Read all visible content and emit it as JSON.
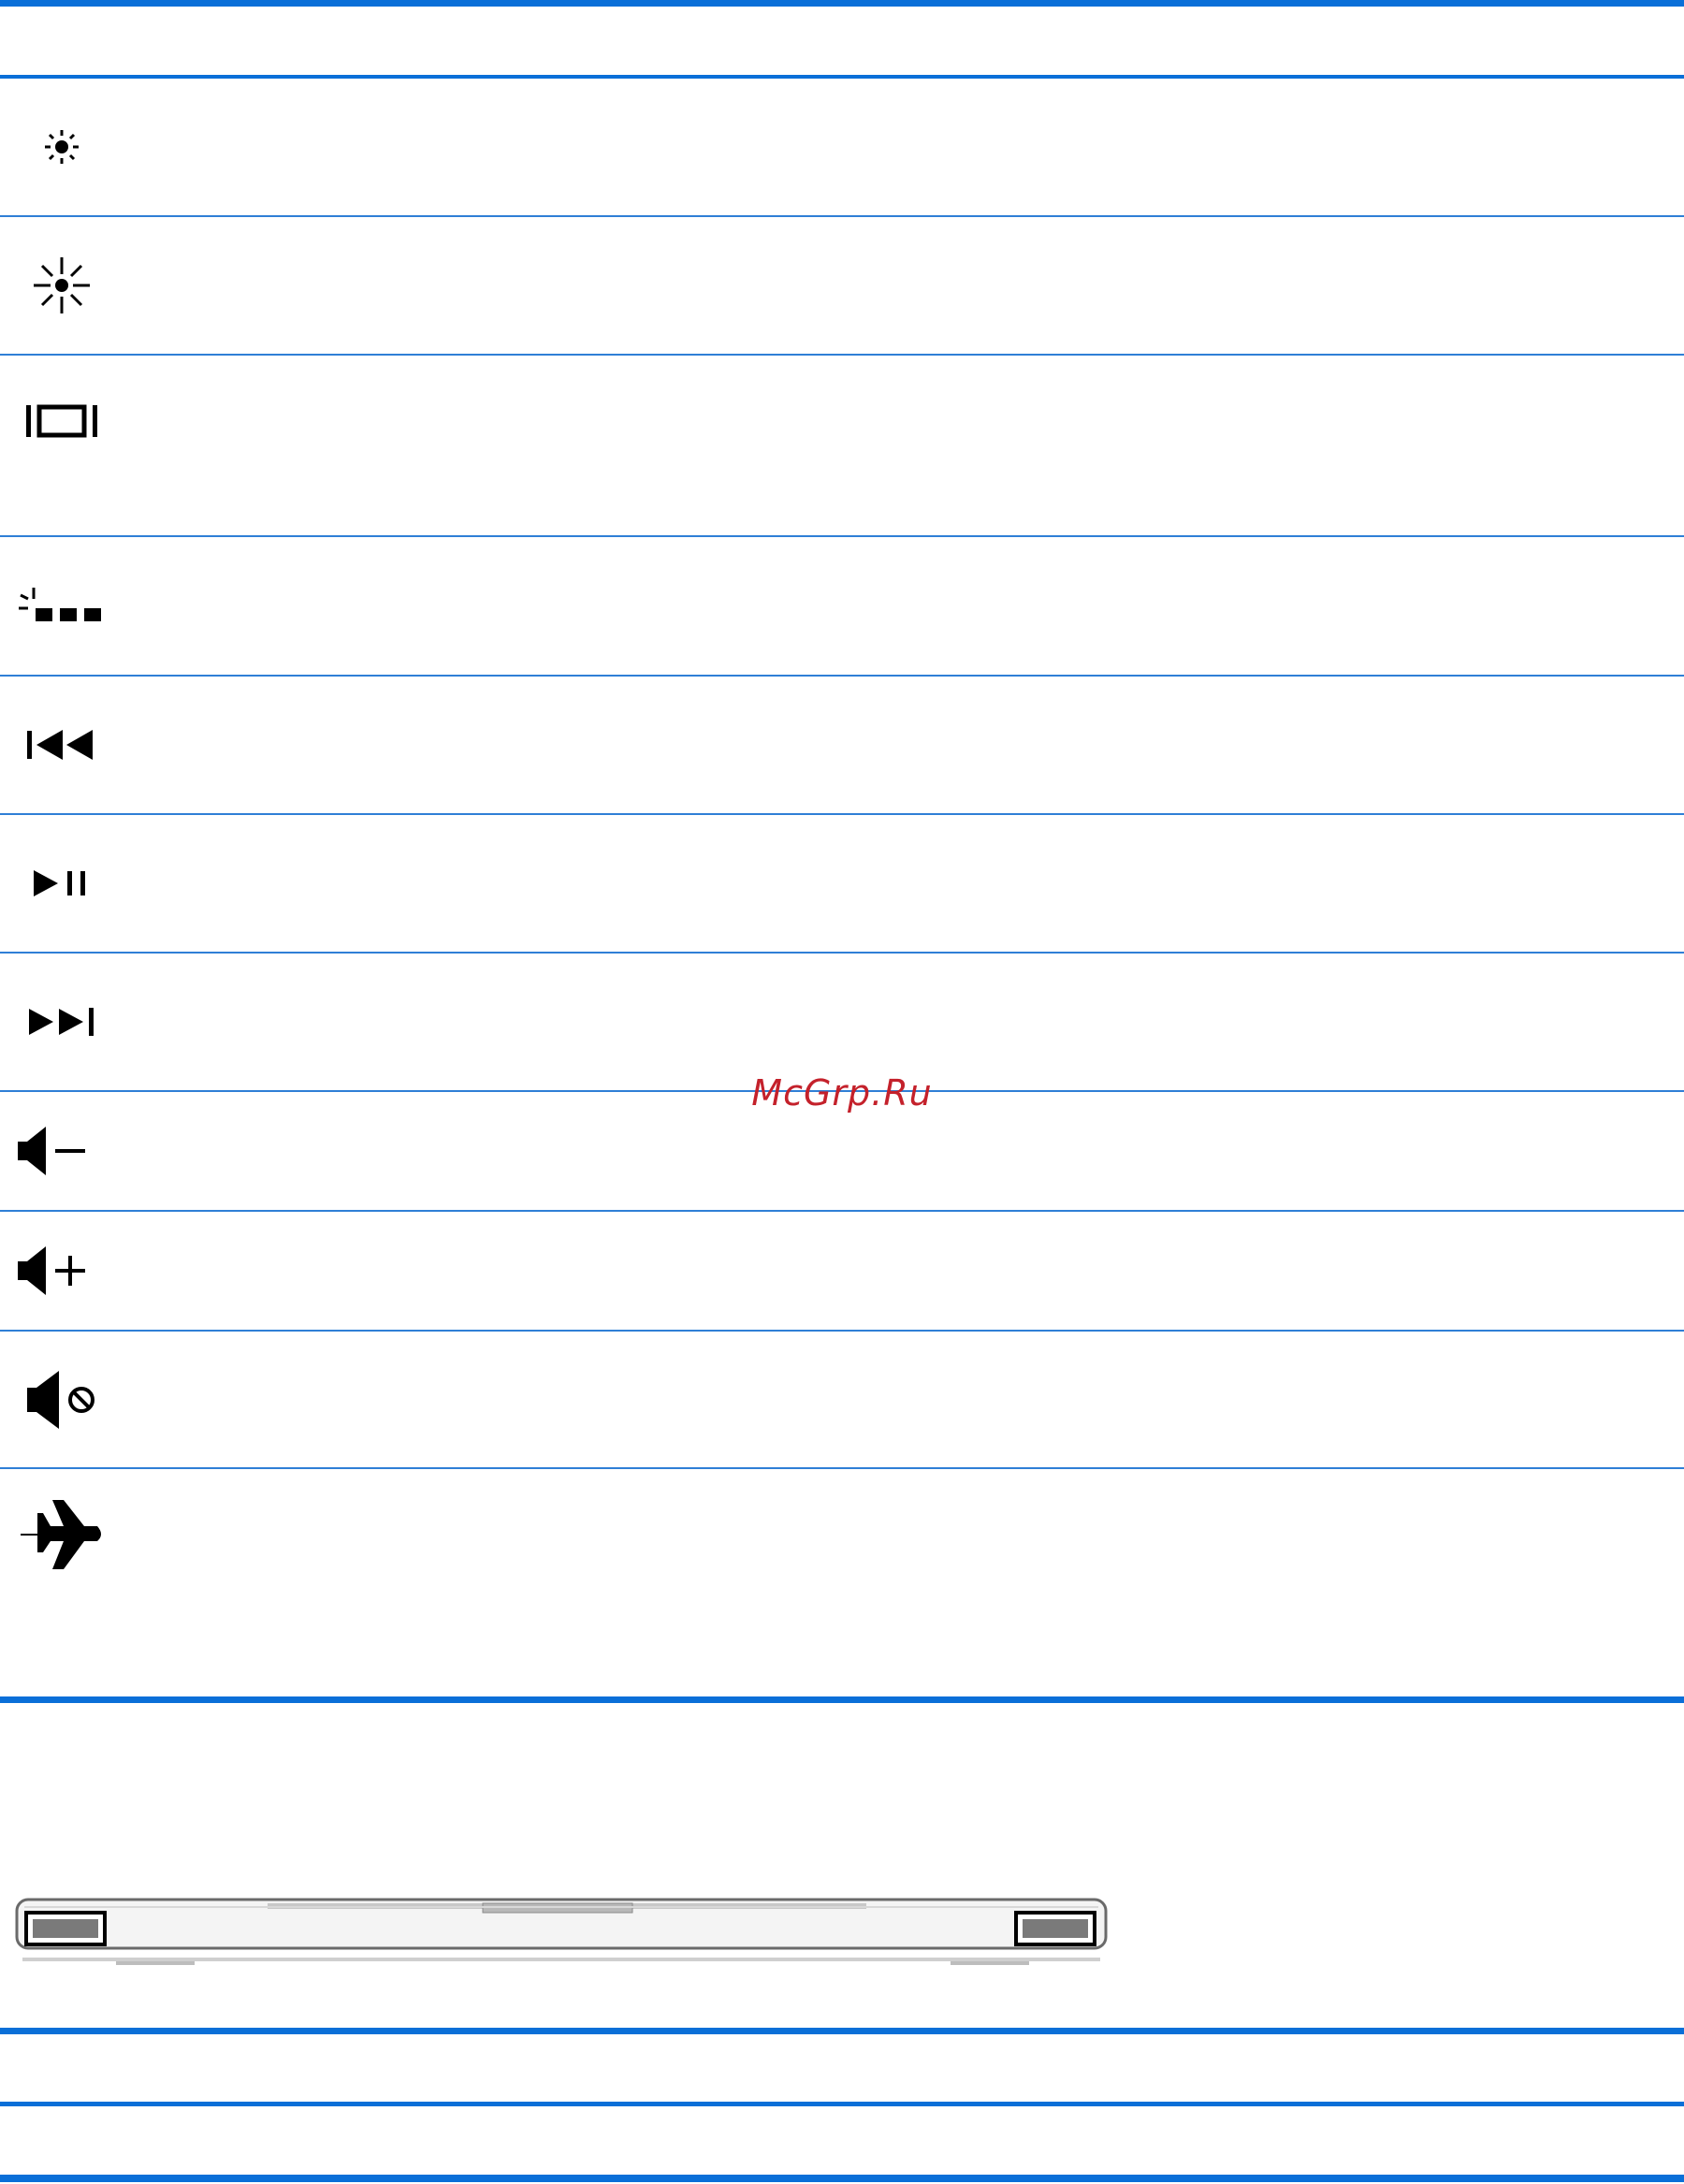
{
  "watermark": {
    "text": "McGrp.Ru",
    "color": "#c4212b"
  },
  "colors": {
    "rule": "#0a6fd8",
    "icon": "#000000"
  },
  "key_icons": [
    "brightness-down-icon",
    "brightness-up-icon",
    "switch-display-icon",
    "keyboard-backlight-icon",
    "previous-track-icon",
    "play-pause-icon",
    "next-track-icon",
    "volume-down-icon",
    "volume-up-icon",
    "mute-icon",
    "airplane-mode-icon"
  ],
  "illustration": {
    "name": "laptop-front-speakers",
    "highlighted_parts": [
      "left-speaker",
      "right-speaker"
    ]
  }
}
